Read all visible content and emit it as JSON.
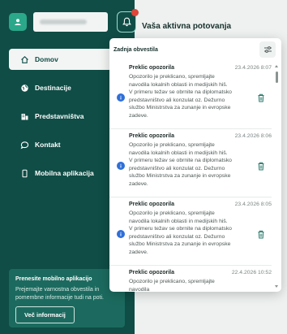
{
  "user": {
    "avatar_icon": "user-icon",
    "name_masked": ""
  },
  "bell": {
    "icon": "bell-icon",
    "badge_color": "#e0463a"
  },
  "nav": {
    "items": [
      {
        "label": "Domov",
        "icon": "home-icon",
        "active": true
      },
      {
        "label": "Destinacije",
        "icon": "globe-icon",
        "active": false
      },
      {
        "label": "Predstavništva",
        "icon": "building-icon",
        "active": false
      },
      {
        "label": "Kontakt",
        "icon": "chat-icon",
        "active": false
      },
      {
        "label": "Mobilna aplikacija",
        "icon": "phone-icon",
        "active": false
      }
    ]
  },
  "promo": {
    "title": "Prenesite mobilno aplikacijo",
    "text": "Prejemajte varnostna obvestila in pomembne informacije tudi na poti.",
    "button": "Več informacij"
  },
  "page": {
    "title": "Vaša aktivna potovanja"
  },
  "notifications": {
    "header": "Zadnja obvestila",
    "filter_icon": "sliders-icon",
    "items": [
      {
        "title": "Preklic opozorila",
        "date": "23.4.2026 8:07",
        "body": "Opozorilo je preklicano, spremljajte navodila lokalnih oblasti in medijskih hiš. V primeru težav se obrnite na diplomatsko predstavništvo ali konzulat oz. Dežurno službo Ministrstva za zunanje in evropske zadeve."
      },
      {
        "title": "Preklic opozorila",
        "date": "23.4.2026 8:06",
        "body": "Opozorilo je preklicano, spremljajte navodila lokalnih oblasti in medijskih hiš. V primeru težav se obrnite na diplomatsko predstavništvo ali konzulat oz. Dežurno službo Ministrstva za zunanje in evropske zadeve."
      },
      {
        "title": "Preklic opozorila",
        "date": "23.4.2026 8:05",
        "body": "Opozorilo je preklicano, spremljajte navodila lokalnih oblasti in medijskih hiš. V primeru težav se obrnite na diplomatsko predstavništvo ali konzulat oz. Dežurno službo Ministrstva za zunanje in evropske zadeve."
      },
      {
        "title": "Preklic opozorila",
        "date": "22.4.2026 10:52",
        "body": "Opozorilo je preklicano, spremljajte navodila"
      }
    ]
  }
}
